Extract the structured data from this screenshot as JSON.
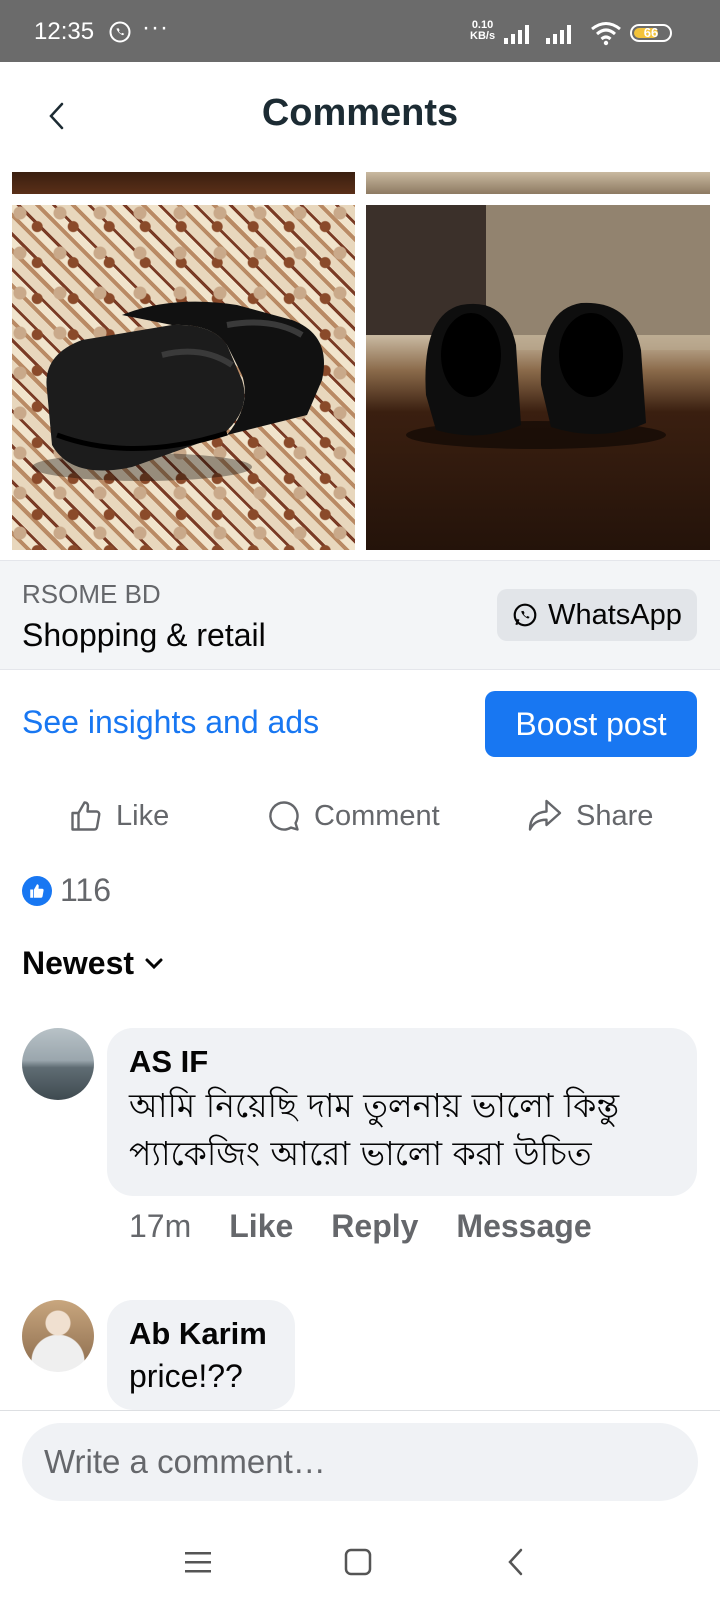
{
  "status_bar": {
    "time": "12:35",
    "dots": "···",
    "speed_value": "0.10",
    "speed_unit": "KB/s",
    "battery": "66"
  },
  "header": {
    "title": "Comments"
  },
  "page": {
    "name": "RSOME BD",
    "category": "Shopping & retail",
    "whatsapp_label": "WhatsApp"
  },
  "insights": {
    "link_label": "See insights and ads",
    "boost_label": "Boost post"
  },
  "actions": {
    "like": "Like",
    "comment": "Comment",
    "share": "Share"
  },
  "reactions": {
    "count": "116"
  },
  "sort": {
    "label": "Newest"
  },
  "comments": [
    {
      "author": "AS IF",
      "text": "আমি নিয়েছি দাম তুলনায় ভালো কিন্তু প্যাকেজিং আরো ভালো করা উচিত",
      "time": "17m",
      "like": "Like",
      "reply": "Reply",
      "message": "Message"
    },
    {
      "author": "Ab Karim",
      "text": "price!??"
    }
  ],
  "composer": {
    "placeholder": "Write a comment…"
  },
  "colors": {
    "accent": "#1877f2",
    "status_bar": "#6b6b6b",
    "bubble": "#f0f2f5",
    "muted_text": "#65676b"
  }
}
